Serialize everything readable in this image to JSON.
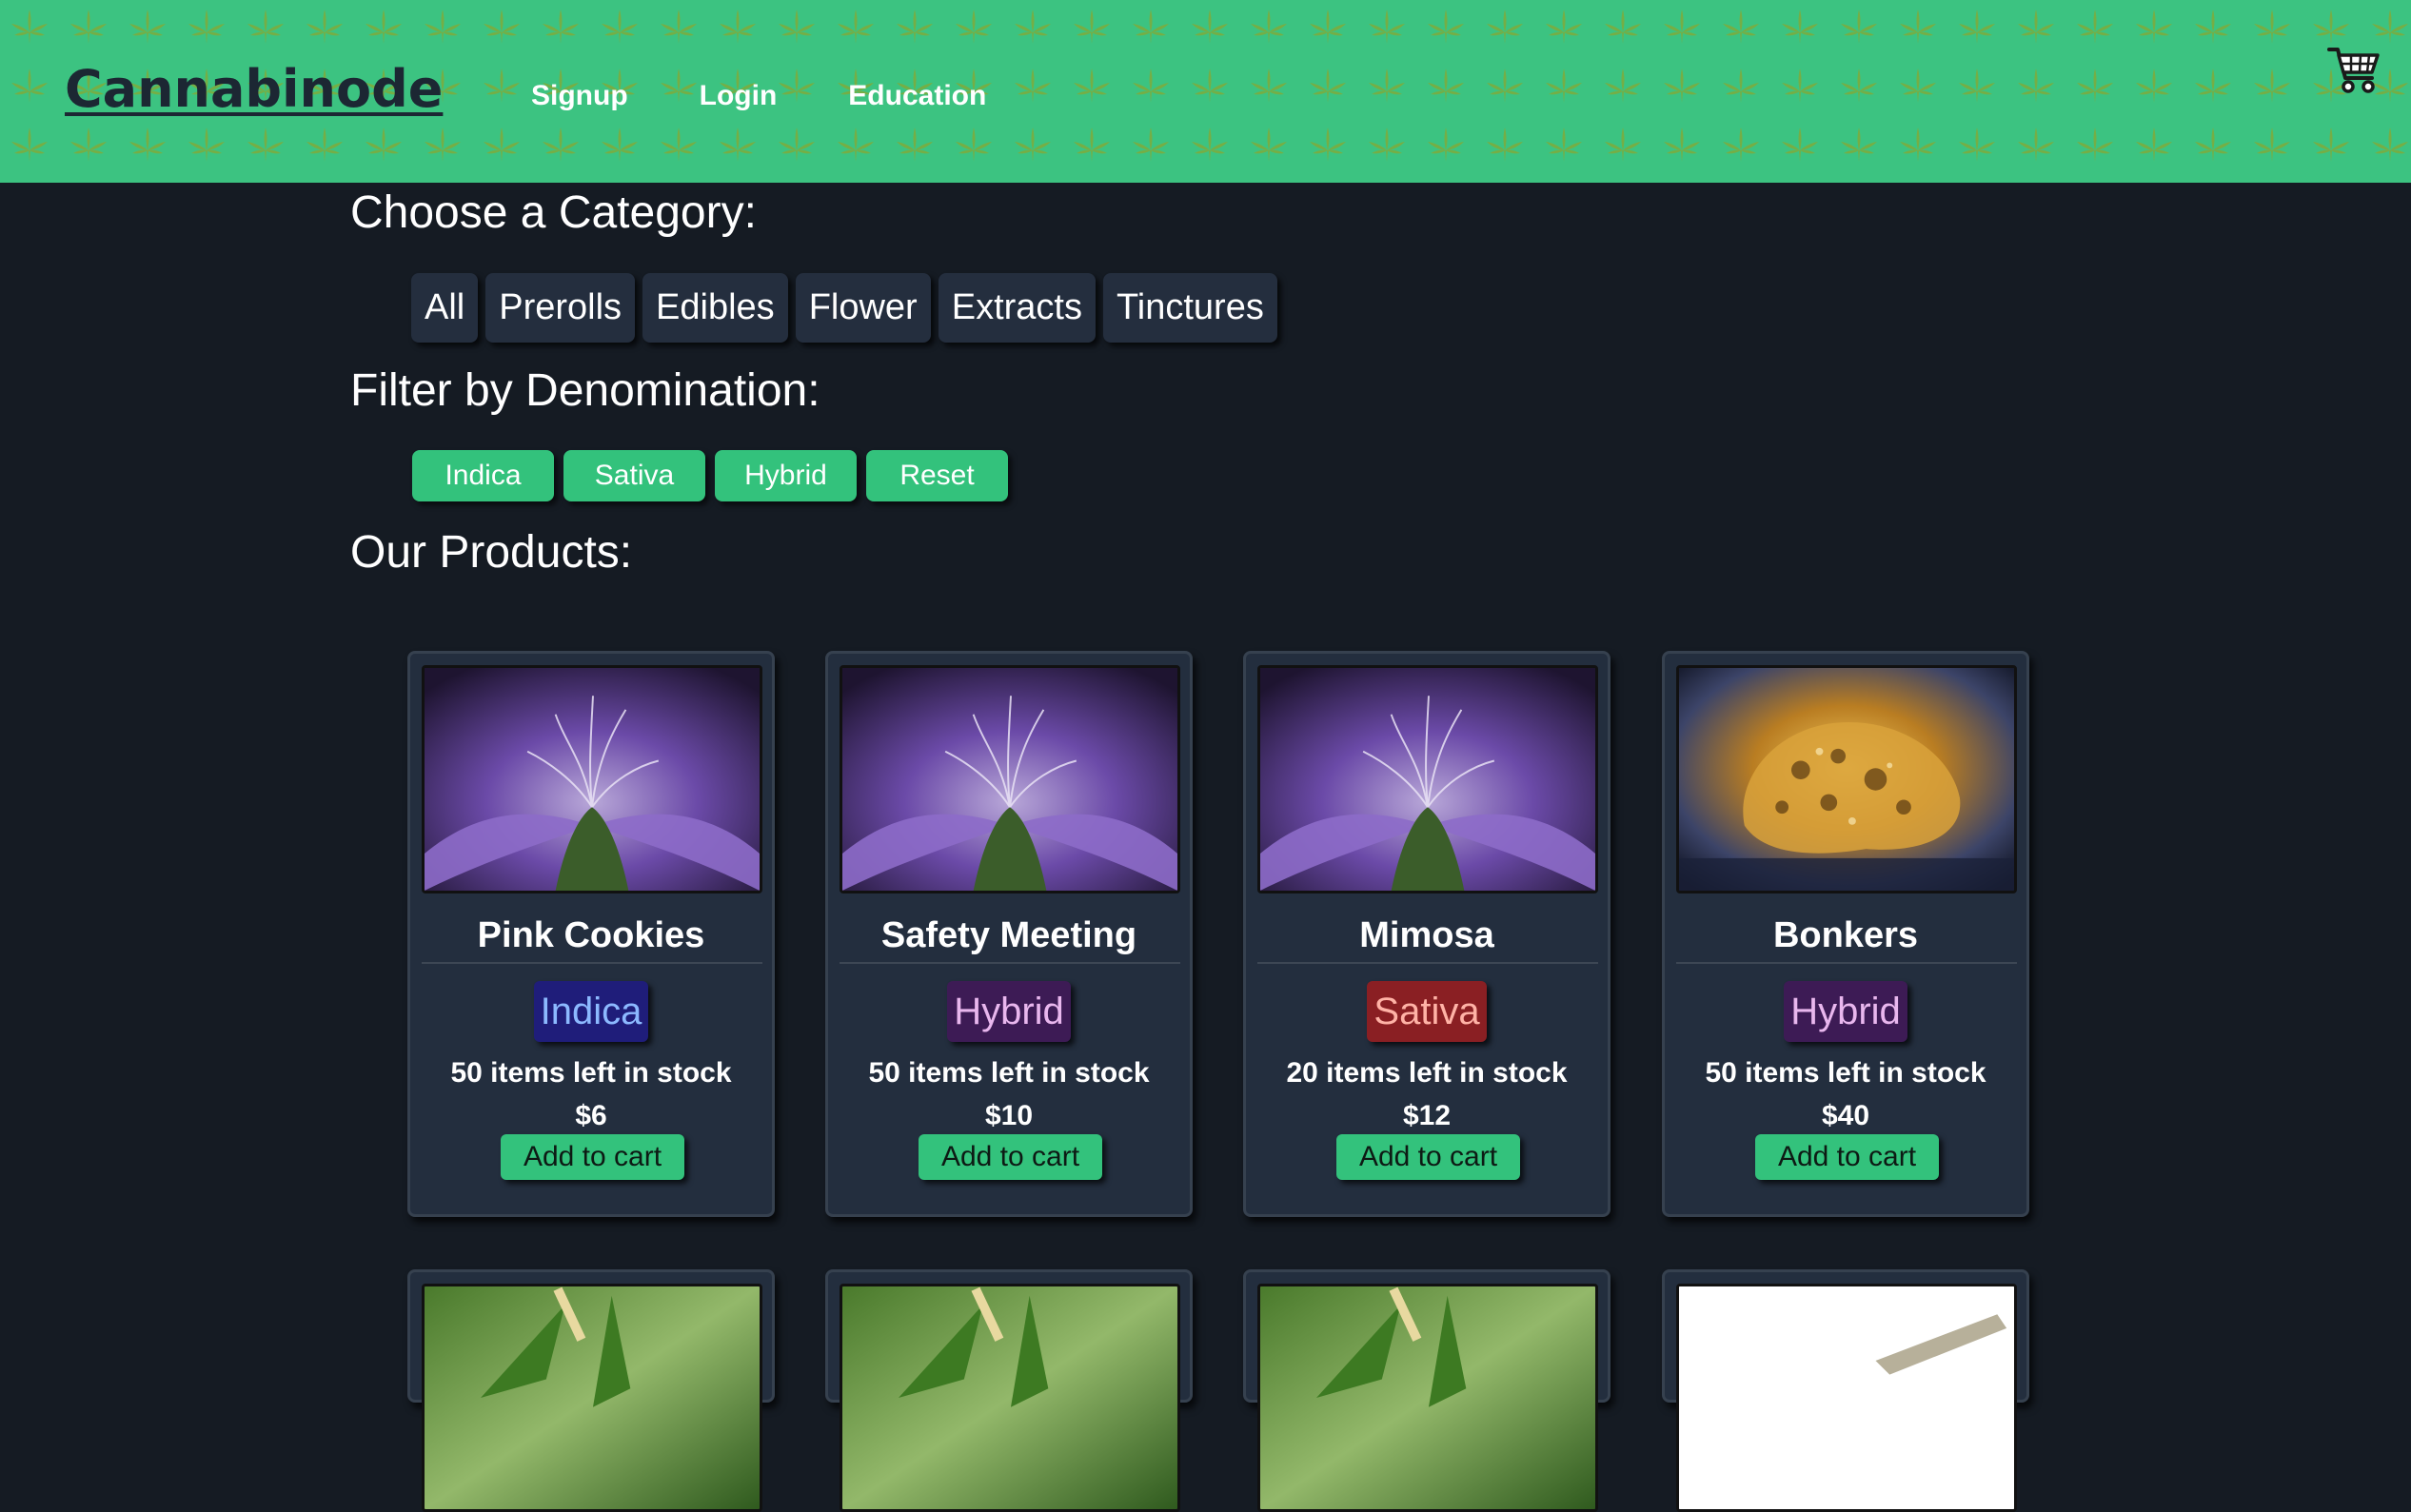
{
  "header": {
    "brand": "Cannabinode",
    "nav": [
      "Signup",
      "Login",
      "Education"
    ],
    "cart_icon": "shopping-cart-icon",
    "background_color": "#3cc381",
    "pattern_icon": "cannabis-leaf-icon"
  },
  "category": {
    "title": "Choose a Category:",
    "options": [
      "All",
      "Prerolls",
      "Edibles",
      "Flower",
      "Extracts",
      "Tinctures"
    ]
  },
  "denomination": {
    "title": "Filter by Denomination:",
    "options": [
      "Indica",
      "Sativa",
      "Hybrid",
      "Reset"
    ]
  },
  "products": {
    "title": "Our Products:",
    "items": [
      {
        "name": "Pink Cookies",
        "type": "Indica",
        "stock": "50 items left in stock",
        "price": "$6",
        "button": "Add to cart",
        "image": "purple-flower-bud"
      },
      {
        "name": "Safety Meeting",
        "type": "Hybrid",
        "stock": "50 items left in stock",
        "price": "$10",
        "button": "Add to cart",
        "image": "purple-flower-bud"
      },
      {
        "name": "Mimosa",
        "type": "Sativa",
        "stock": "20 items left in stock",
        "price": "$12",
        "button": "Add to cart",
        "image": "purple-flower-bud"
      },
      {
        "name": "Bonkers",
        "type": "Hybrid",
        "stock": "50 items left in stock",
        "price": "$40",
        "button": "Add to cart",
        "image": "amber-extract"
      }
    ],
    "partial_row_images": [
      "green-leaf-dropper",
      "green-leaf-dropper",
      "green-leaf-dropper",
      "preroll"
    ]
  },
  "colors": {
    "page_bg": "#151b23",
    "card_bg": "#232e3e",
    "accent_green": "#33c27c",
    "indica": "#1f1d7a",
    "hybrid": "#3d1b55",
    "sativa": "#8a1f23"
  }
}
